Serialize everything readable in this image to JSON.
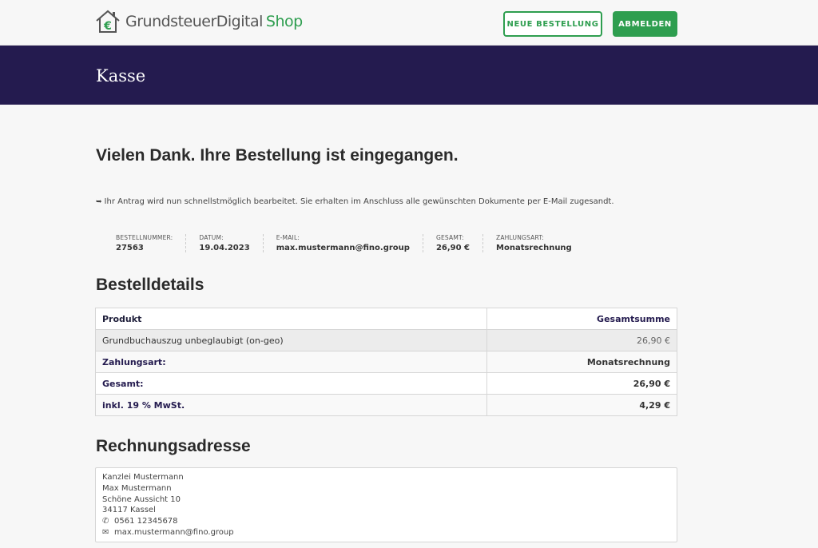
{
  "header": {
    "logo_main": "GrundsteuerDigital",
    "logo_shop": "Shop",
    "btn_new_order": "NEUE BESTELLUNG",
    "btn_logout": "ABMELDEN"
  },
  "banner": {
    "title": "Kasse"
  },
  "confirmation": {
    "heading": "Vielen Dank. Ihre Bestellung ist eingegangen.",
    "notice": "Ihr Antrag wird nun schnellstmöglich bearbeitet. Sie erhalten im Anschluss alle gewünschten Dokumente per E-Mail zugesandt."
  },
  "overview": [
    {
      "label": "BESTELLNUMMER:",
      "value": "27563"
    },
    {
      "label": "DATUM:",
      "value": "19.04.2023"
    },
    {
      "label": "E-MAIL:",
      "value": "max.mustermann@fino.group"
    },
    {
      "label": "GESAMT:",
      "value": "26,90 €"
    },
    {
      "label": "ZAHLUNGSART:",
      "value": "Monatsrechnung"
    }
  ],
  "details": {
    "title": "Bestelldetails",
    "col_product": "Produkt",
    "col_total": "Gesamtsumme",
    "product_name": "Grundbuchauszug unbeglaubigt (on-geo)",
    "product_total": "26,90 €",
    "payment_label": "Zahlungsart:",
    "payment_value": "Monatsrechnung",
    "total_label": "Gesamt:",
    "total_value": "26,90 €",
    "tax_label": "inkl. 19 % MwSt.",
    "tax_value": "4,29 €"
  },
  "billing": {
    "title": "Rechnungsadresse",
    "company": "Kanzlei Mustermann",
    "name": "Max Mustermann",
    "street": "Schöne Aussicht 10",
    "city": "34117 Kassel",
    "phone": "0561 12345678",
    "email": "max.mustermann@fino.group"
  },
  "colors": {
    "brand_green": "#2e9e4f",
    "banner_purple": "#241b4f"
  }
}
